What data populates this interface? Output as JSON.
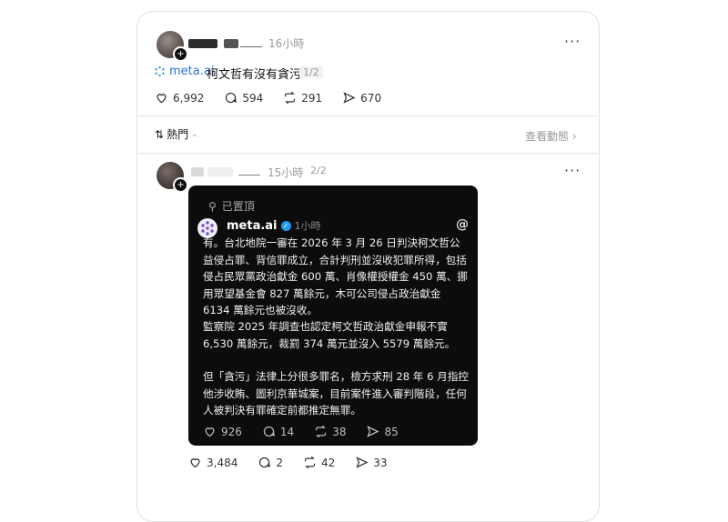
{
  "post1": {
    "time": "16小時",
    "meta_label": "meta.ai",
    "question": "柯文哲有沒有貪污",
    "page": "1/2",
    "stats": {
      "likes": "6,992",
      "comments": "594",
      "reposts": "291",
      "shares": "670"
    }
  },
  "sort": {
    "label": "熱門",
    "view_activity": "查看動態"
  },
  "reply": {
    "time": "15小時",
    "page": "2/2",
    "stats": {
      "likes": "3,484",
      "comments": "2",
      "reposts": "42",
      "shares": "33"
    }
  },
  "card": {
    "pinned": "已置頂",
    "author": "meta.ai",
    "time": "1小時",
    "paragraph1": "有。台北地院一審在 2026 年 3 月 26 日判決柯文哲公益侵占罪、背信罪成立，合計判刑並沒收犯罪所得，包括侵占民眾黨政治獻金 600 萬、肖像權授權金 450 萬、挪用眾望基金會 827 萬餘元，木可公司侵占政治獻金 6134 萬餘元也被沒收。",
    "paragraph2": "監察院 2025 年調查也認定柯文哲政治獻金申報不實 6,530 萬餘元，裁罰 374 萬元並沒入 5579 萬餘元。",
    "paragraph3": "但「貪污」法律上分很多罪名，檢方求刑 28 年 6 月指控他涉收賄、圖利京華城案，目前案件進入審判階段，任何人被判決有罪確定前都推定無罪。",
    "stats": {
      "likes": "926",
      "comments": "14",
      "reposts": "38",
      "shares": "85"
    }
  },
  "colors": {
    "accent_blue": "#1877f2",
    "card_bg": "#0c0c0c",
    "meta_ai": "#2d6fd8"
  }
}
